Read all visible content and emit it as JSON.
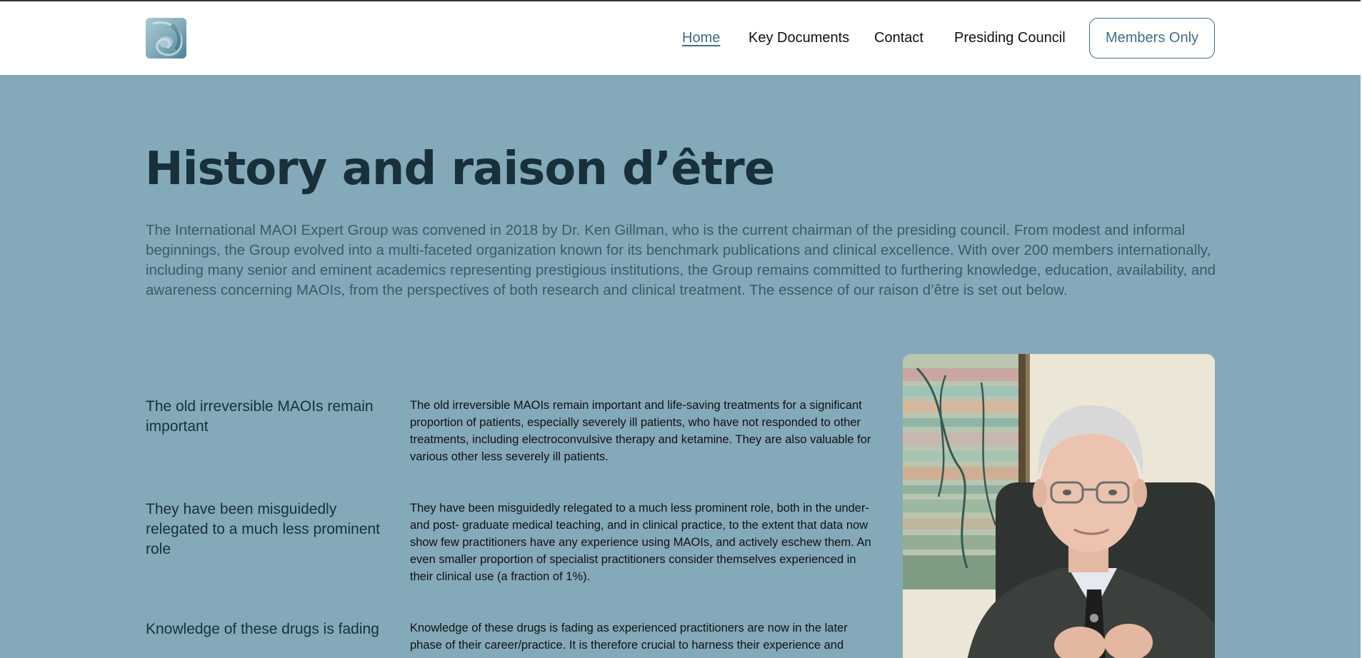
{
  "header": {
    "logo_alt": "logo",
    "nav": [
      {
        "label": "Home"
      },
      {
        "label": "Key Documents"
      },
      {
        "label": "Contact"
      },
      {
        "label": "Presiding Council"
      }
    ],
    "members_button": "Members Only"
  },
  "main": {
    "title": "History and raison d’être",
    "intro": "The International MAOI Expert Group was convened in 2018 by Dr. Ken Gillman, who is the current chairman of the presiding council. From modest and informal beginnings, the Group evolved into a multi-faceted organization known for its benchmark publications and clinical excellence. With over 200 members internationally, including many senior and eminent academics representing prestigious institutions, the Group remains committed to furthering knowledge, education, availability, and awareness concerning MAOIs, from the perspectives of both research and clinical treatment. The essence of our raison d’être is set out below.",
    "rows": [
      {
        "heading": "The old irreversible MAOIs remain important",
        "text": "The old irreversible MAOIs remain important and life-saving treatments for a significant proportion of patients, especially severely ill patients, who have not responded to other treatments, including electroconvulsive therapy and ketamine. They are also valuable for various other less severely ill patients."
      },
      {
        "heading": "They have been misguidedly relegated to a much less prominent role",
        "text": "They have been misguidedly relegated to a much less prominent role, both in the under- and post- graduate medical teaching, and in clinical practice, to the extent that data now show few practitioners have any experience using MAOIs, and actively eschew them. An even smaller proportion of specialist practitioners consider themselves experienced in their clinical use (a fraction of 1%)."
      },
      {
        "heading": "Knowledge of these drugs is fading",
        "text": "Knowledge of these drugs is fading as experienced practitioners are now in the later phase of their career/practice. It is therefore crucial to harness their experience and"
      }
    ]
  },
  "colors": {
    "section_bg": "#84a9b9",
    "accent": "#3e6f86",
    "title": "#17303a"
  },
  "icons": {
    "logo": "spiral-logo-icon"
  }
}
